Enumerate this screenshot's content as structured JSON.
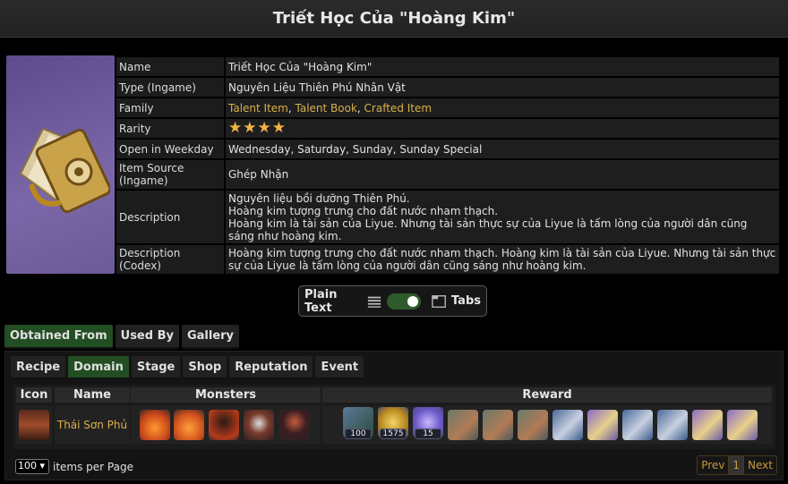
{
  "title": "Triết Học Của \"Hoàng Kim\"",
  "info": {
    "name_label": "Name",
    "name": "Triết Học Của \"Hoàng Kim\"",
    "type_label": "Type (Ingame)",
    "type": "Nguyên Liệu Thiên Phú Nhân Vật",
    "family_label": "Family",
    "family": [
      "Talent Item",
      "Talent Book",
      "Crafted Item"
    ],
    "family_sep": ", ",
    "rarity_label": "Rarity",
    "rarity": 4,
    "rarity_stars": "★★★★",
    "weekday_label": "Open in Weekday",
    "weekday": "Wednesday, Saturday, Sunday, Sunday Special",
    "source_label": "Item Source (Ingame)",
    "source": "Ghép Nhận",
    "desc_label": "Description",
    "desc_lines": [
      "Nguyên liệu bồi dưỡng Thiên Phú.",
      "Hoàng kim tượng trưng cho đất nước nham thạch.",
      "Hoàng kim là tài sản của Liyue. Nhưng tài sản thực sự của Liyue là tấm lòng của người dân cũng sáng như hoàng kim."
    ],
    "codex_label": "Description (Codex)",
    "codex": "Hoàng kim tượng trưng cho đất nước nham thạch. Hoàng kim là tài sản của Liyue. Nhưng tài sản thực sự của Liyue là tấm lòng của người dân cũng sáng như hoàng kim."
  },
  "toggle": {
    "left_label": "Plain Text",
    "right_label": "Tabs",
    "state": "tabs"
  },
  "tabs_main": [
    "Obtained From",
    "Used By",
    "Gallery"
  ],
  "tabs_sub": [
    "Recipe",
    "Domain",
    "Stage",
    "Shop",
    "Reputation",
    "Event"
  ],
  "table": {
    "headers": {
      "icon": "Icon",
      "name": "Name",
      "monsters": "Monsters",
      "reward": "Reward"
    },
    "row": {
      "name": "Thái Sơn Phủ",
      "rewards": [
        {
          "icon": "adventure-exp-icon",
          "count": "100"
        },
        {
          "icon": "mora-icon",
          "count": "1575"
        },
        {
          "icon": "companionship-exp-icon",
          "count": "15"
        }
      ]
    }
  },
  "per_page": {
    "value": "100",
    "label": "items per Page"
  },
  "pager": {
    "prev": "Prev",
    "page": "1",
    "next": "Next"
  },
  "colors": {
    "accent_green": "#234d22",
    "gold_text": "#d9b04a",
    "star": "#f0b440"
  }
}
